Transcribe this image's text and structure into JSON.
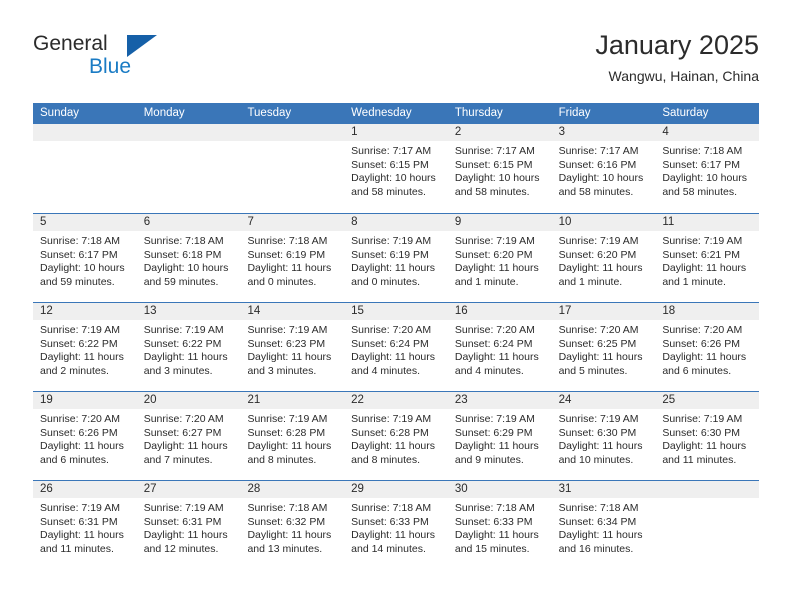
{
  "brand": {
    "name_part1": "General",
    "name_part2": "Blue",
    "logo_icon": "triangle-logo-icon"
  },
  "header": {
    "title": "January 2025",
    "subtitle": "Wangwu, Hainan, China"
  },
  "colors": {
    "header_blue": "#3a76b8",
    "daynum_band": "#efefef",
    "brand_blue": "#1a7bc4",
    "logo_blue": "#1560a8",
    "text": "#2b2b2b"
  },
  "weekdays": [
    "Sunday",
    "Monday",
    "Tuesday",
    "Wednesday",
    "Thursday",
    "Friday",
    "Saturday"
  ],
  "weeks": [
    [
      {
        "day": "",
        "lines": []
      },
      {
        "day": "",
        "lines": []
      },
      {
        "day": "",
        "lines": []
      },
      {
        "day": "1",
        "lines": [
          "Sunrise: 7:17 AM",
          "Sunset: 6:15 PM",
          "Daylight: 10 hours",
          "and 58 minutes."
        ]
      },
      {
        "day": "2",
        "lines": [
          "Sunrise: 7:17 AM",
          "Sunset: 6:15 PM",
          "Daylight: 10 hours",
          "and 58 minutes."
        ]
      },
      {
        "day": "3",
        "lines": [
          "Sunrise: 7:17 AM",
          "Sunset: 6:16 PM",
          "Daylight: 10 hours",
          "and 58 minutes."
        ]
      },
      {
        "day": "4",
        "lines": [
          "Sunrise: 7:18 AM",
          "Sunset: 6:17 PM",
          "Daylight: 10 hours",
          "and 58 minutes."
        ]
      }
    ],
    [
      {
        "day": "5",
        "lines": [
          "Sunrise: 7:18 AM",
          "Sunset: 6:17 PM",
          "Daylight: 10 hours",
          "and 59 minutes."
        ]
      },
      {
        "day": "6",
        "lines": [
          "Sunrise: 7:18 AM",
          "Sunset: 6:18 PM",
          "Daylight: 10 hours",
          "and 59 minutes."
        ]
      },
      {
        "day": "7",
        "lines": [
          "Sunrise: 7:18 AM",
          "Sunset: 6:19 PM",
          "Daylight: 11 hours",
          "and 0 minutes."
        ]
      },
      {
        "day": "8",
        "lines": [
          "Sunrise: 7:19 AM",
          "Sunset: 6:19 PM",
          "Daylight: 11 hours",
          "and 0 minutes."
        ]
      },
      {
        "day": "9",
        "lines": [
          "Sunrise: 7:19 AM",
          "Sunset: 6:20 PM",
          "Daylight: 11 hours",
          "and 1 minute."
        ]
      },
      {
        "day": "10",
        "lines": [
          "Sunrise: 7:19 AM",
          "Sunset: 6:20 PM",
          "Daylight: 11 hours",
          "and 1 minute."
        ]
      },
      {
        "day": "11",
        "lines": [
          "Sunrise: 7:19 AM",
          "Sunset: 6:21 PM",
          "Daylight: 11 hours",
          "and 1 minute."
        ]
      }
    ],
    [
      {
        "day": "12",
        "lines": [
          "Sunrise: 7:19 AM",
          "Sunset: 6:22 PM",
          "Daylight: 11 hours",
          "and 2 minutes."
        ]
      },
      {
        "day": "13",
        "lines": [
          "Sunrise: 7:19 AM",
          "Sunset: 6:22 PM",
          "Daylight: 11 hours",
          "and 3 minutes."
        ]
      },
      {
        "day": "14",
        "lines": [
          "Sunrise: 7:19 AM",
          "Sunset: 6:23 PM",
          "Daylight: 11 hours",
          "and 3 minutes."
        ]
      },
      {
        "day": "15",
        "lines": [
          "Sunrise: 7:20 AM",
          "Sunset: 6:24 PM",
          "Daylight: 11 hours",
          "and 4 minutes."
        ]
      },
      {
        "day": "16",
        "lines": [
          "Sunrise: 7:20 AM",
          "Sunset: 6:24 PM",
          "Daylight: 11 hours",
          "and 4 minutes."
        ]
      },
      {
        "day": "17",
        "lines": [
          "Sunrise: 7:20 AM",
          "Sunset: 6:25 PM",
          "Daylight: 11 hours",
          "and 5 minutes."
        ]
      },
      {
        "day": "18",
        "lines": [
          "Sunrise: 7:20 AM",
          "Sunset: 6:26 PM",
          "Daylight: 11 hours",
          "and 6 minutes."
        ]
      }
    ],
    [
      {
        "day": "19",
        "lines": [
          "Sunrise: 7:20 AM",
          "Sunset: 6:26 PM",
          "Daylight: 11 hours",
          "and 6 minutes."
        ]
      },
      {
        "day": "20",
        "lines": [
          "Sunrise: 7:20 AM",
          "Sunset: 6:27 PM",
          "Daylight: 11 hours",
          "and 7 minutes."
        ]
      },
      {
        "day": "21",
        "lines": [
          "Sunrise: 7:19 AM",
          "Sunset: 6:28 PM",
          "Daylight: 11 hours",
          "and 8 minutes."
        ]
      },
      {
        "day": "22",
        "lines": [
          "Sunrise: 7:19 AM",
          "Sunset: 6:28 PM",
          "Daylight: 11 hours",
          "and 8 minutes."
        ]
      },
      {
        "day": "23",
        "lines": [
          "Sunrise: 7:19 AM",
          "Sunset: 6:29 PM",
          "Daylight: 11 hours",
          "and 9 minutes."
        ]
      },
      {
        "day": "24",
        "lines": [
          "Sunrise: 7:19 AM",
          "Sunset: 6:30 PM",
          "Daylight: 11 hours",
          "and 10 minutes."
        ]
      },
      {
        "day": "25",
        "lines": [
          "Sunrise: 7:19 AM",
          "Sunset: 6:30 PM",
          "Daylight: 11 hours",
          "and 11 minutes."
        ]
      }
    ],
    [
      {
        "day": "26",
        "lines": [
          "Sunrise: 7:19 AM",
          "Sunset: 6:31 PM",
          "Daylight: 11 hours",
          "and 11 minutes."
        ]
      },
      {
        "day": "27",
        "lines": [
          "Sunrise: 7:19 AM",
          "Sunset: 6:31 PM",
          "Daylight: 11 hours",
          "and 12 minutes."
        ]
      },
      {
        "day": "28",
        "lines": [
          "Sunrise: 7:18 AM",
          "Sunset: 6:32 PM",
          "Daylight: 11 hours",
          "and 13 minutes."
        ]
      },
      {
        "day": "29",
        "lines": [
          "Sunrise: 7:18 AM",
          "Sunset: 6:33 PM",
          "Daylight: 11 hours",
          "and 14 minutes."
        ]
      },
      {
        "day": "30",
        "lines": [
          "Sunrise: 7:18 AM",
          "Sunset: 6:33 PM",
          "Daylight: 11 hours",
          "and 15 minutes."
        ]
      },
      {
        "day": "31",
        "lines": [
          "Sunrise: 7:18 AM",
          "Sunset: 6:34 PM",
          "Daylight: 11 hours",
          "and 16 minutes."
        ]
      },
      {
        "day": "",
        "lines": []
      }
    ]
  ]
}
